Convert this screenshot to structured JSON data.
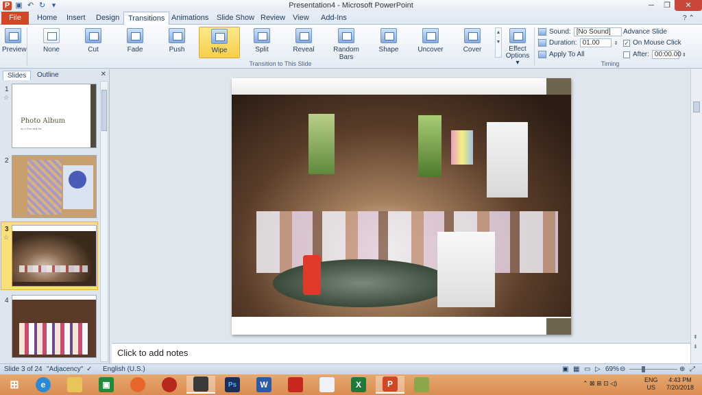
{
  "window": {
    "title": "Presentation4 - Microsoft PowerPoint"
  },
  "colors": {
    "file_tab": "#d24726",
    "selected_transition": "#f7ce4a",
    "ribbon_bg": "#e4ebf4",
    "taskbar": "#d98d52"
  },
  "tabs": [
    "File",
    "Home",
    "Insert",
    "Design",
    "Transitions",
    "Animations",
    "Slide Show",
    "Review",
    "View",
    "Add-Ins"
  ],
  "ribbon": {
    "preview_label": "Preview",
    "transitions": [
      "None",
      "Cut",
      "Fade",
      "Push",
      "Wipe",
      "Split",
      "Reveal",
      "Random Bars",
      "Shape",
      "Uncover",
      "Cover"
    ],
    "effect_options": [
      "Effect",
      "Options ▾"
    ],
    "group_transitions": "Transition to This Slide",
    "group_timing": "Timing",
    "sound_label": "Sound:",
    "sound_value": "[No Sound]",
    "duration_label": "Duration:",
    "duration_value": "01.00",
    "apply_all": "Apply To All",
    "advance_label": "Advance Slide",
    "on_mouse_click": "On Mouse Click",
    "after_label": "After:",
    "after_value": "00:00.00"
  },
  "pane": {
    "tab_slides": "Slides",
    "tab_outline": "Outline",
    "slide1_title": "Photo Album",
    "slide1_sub": "by a Paw Wai Na",
    "numbers": [
      "1",
      "2",
      "3",
      "4"
    ]
  },
  "notes_placeholder": "Click to add notes",
  "status": {
    "slide": "Slide 3 of 24",
    "theme": "\"Adjacency\"",
    "language": "English (U.S.)",
    "zoom": "69%"
  },
  "tray": {
    "lang1": "ENG",
    "lang2": "US",
    "time": "4:43 PM",
    "date": "7/20/2018"
  }
}
